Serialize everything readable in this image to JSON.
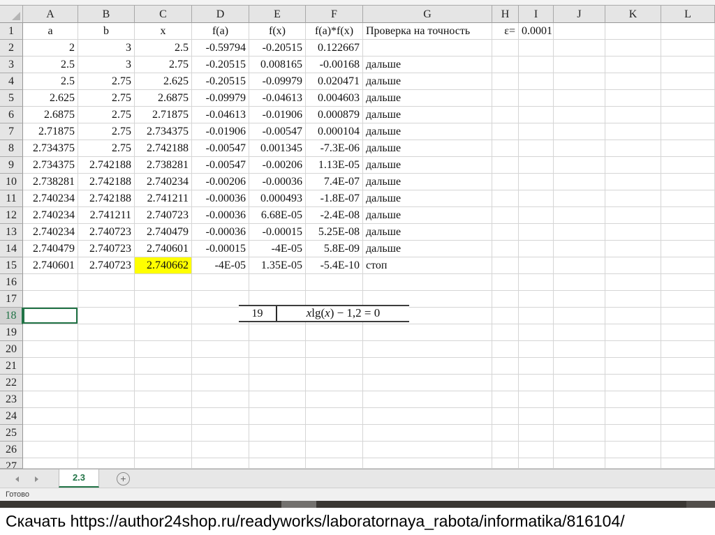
{
  "spreadsheet": {
    "column_letters": [
      "A",
      "B",
      "C",
      "D",
      "E",
      "F",
      "G",
      "H",
      "I",
      "J",
      "K",
      "L"
    ],
    "row_numbers": [
      "1",
      "2",
      "3",
      "4",
      "5",
      "6",
      "7",
      "8",
      "9",
      "10",
      "11",
      "12",
      "13",
      "14",
      "15",
      "16",
      "17",
      "18",
      "19",
      "20",
      "21",
      "22",
      "23",
      "24",
      "25",
      "26",
      "27"
    ],
    "row_count": 27,
    "header_row": {
      "A": "a",
      "B": "b",
      "C": "x",
      "D": "f(a)",
      "E": "f(x)",
      "F": "f(a)*f(x)",
      "G": "Проверка на точность",
      "H": "ε=",
      "I": "0.0001"
    },
    "data_rows": [
      {
        "row": 2,
        "A": "2",
        "B": "3",
        "C": "2.5",
        "D": "-0.59794",
        "E": "-0.20515",
        "F": "0.122667",
        "G": ""
      },
      {
        "row": 3,
        "A": "2.5",
        "B": "3",
        "C": "2.75",
        "D": "-0.20515",
        "E": "0.008165",
        "F": "-0.00168",
        "G": "дальше"
      },
      {
        "row": 4,
        "A": "2.5",
        "B": "2.75",
        "C": "2.625",
        "D": "-0.20515",
        "E": "-0.09979",
        "F": "0.020471",
        "G": "дальше"
      },
      {
        "row": 5,
        "A": "2.625",
        "B": "2.75",
        "C": "2.6875",
        "D": "-0.09979",
        "E": "-0.04613",
        "F": "0.004603",
        "G": "дальше"
      },
      {
        "row": 6,
        "A": "2.6875",
        "B": "2.75",
        "C": "2.71875",
        "D": "-0.04613",
        "E": "-0.01906",
        "F": "0.000879",
        "G": "дальше"
      },
      {
        "row": 7,
        "A": "2.71875",
        "B": "2.75",
        "C": "2.734375",
        "D": "-0.01906",
        "E": "-0.00547",
        "F": "0.000104",
        "G": "дальше"
      },
      {
        "row": 8,
        "A": "2.734375",
        "B": "2.75",
        "C": "2.742188",
        "D": "-0.00547",
        "E": "0.001345",
        "F": "-7.3E-06",
        "G": "дальше"
      },
      {
        "row": 9,
        "A": "2.734375",
        "B": "2.742188",
        "C": "2.738281",
        "D": "-0.00547",
        "E": "-0.00206",
        "F": "1.13E-05",
        "G": "дальше"
      },
      {
        "row": 10,
        "A": "2.738281",
        "B": "2.742188",
        "C": "2.740234",
        "D": "-0.00206",
        "E": "-0.00036",
        "F": "7.4E-07",
        "G": "дальше"
      },
      {
        "row": 11,
        "A": "2.740234",
        "B": "2.742188",
        "C": "2.741211",
        "D": "-0.00036",
        "E": "0.000493",
        "F": "-1.8E-07",
        "G": "дальше"
      },
      {
        "row": 12,
        "A": "2.740234",
        "B": "2.741211",
        "C": "2.740723",
        "D": "-0.00036",
        "E": "6.68E-05",
        "F": "-2.4E-08",
        "G": "дальше"
      },
      {
        "row": 13,
        "A": "2.740234",
        "B": "2.740723",
        "C": "2.740479",
        "D": "-0.00036",
        "E": "-0.00015",
        "F": "5.25E-08",
        "G": "дальше"
      },
      {
        "row": 14,
        "A": "2.740479",
        "B": "2.740723",
        "C": "2.740601",
        "D": "-0.00015",
        "E": "-4E-05",
        "F": "5.8E-09",
        "G": "дальше"
      },
      {
        "row": 15,
        "A": "2.740601",
        "B": "2.740723",
        "C": "2.740662",
        "D": "-4E-05",
        "E": "1.35E-05",
        "F": "-5.4E-10",
        "G": "стоп"
      }
    ],
    "highlight_cell": "C15",
    "active_cell": "A18",
    "selected_row_header": "18",
    "highlight_color": "#ffff00",
    "accent_green": "#217346"
  },
  "embedded_formula": {
    "index": "19",
    "parts": {
      "var1": "x",
      "func": "lg(",
      "var2": "x",
      "rest": ") − 1,2 = 0"
    }
  },
  "tab_bar": {
    "active_tab": "2.3",
    "new_sheet_label": "+"
  },
  "status_bar": {
    "text": "Готово"
  },
  "footer": {
    "text": "Скачать https://author24shop.ru/readyworks/laboratornaya_rabota/informatika/816104/"
  }
}
